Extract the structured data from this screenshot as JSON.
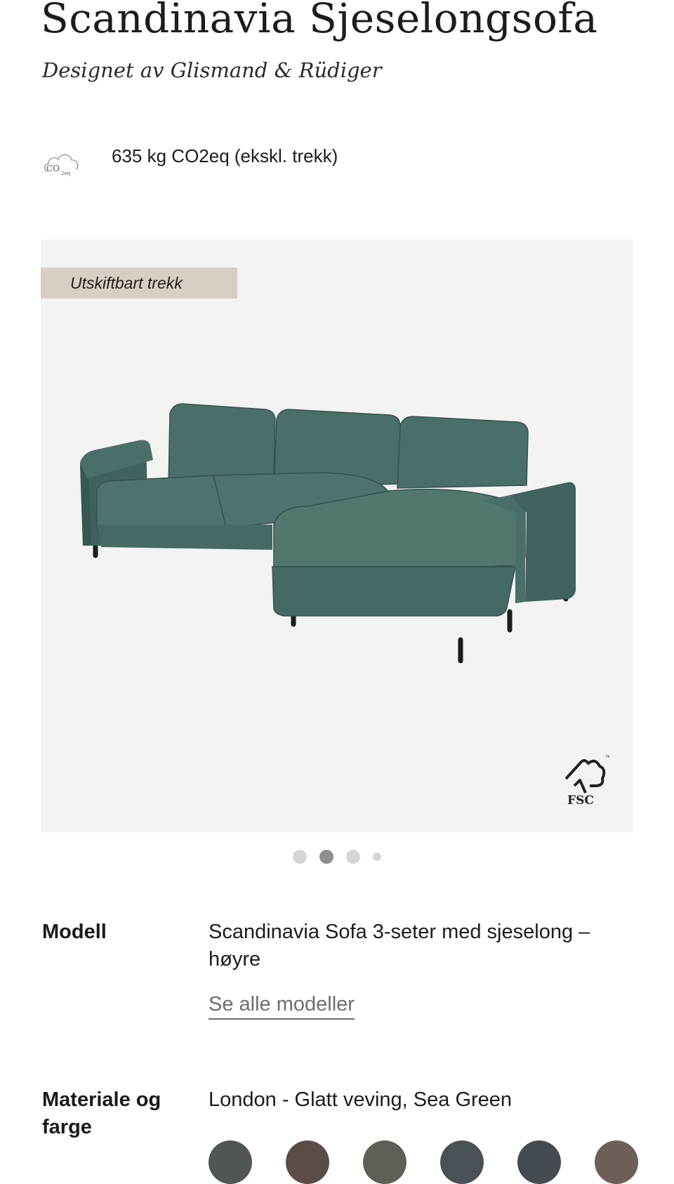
{
  "product": {
    "title": "Scandinavia Sjeselongsofa",
    "designer": "Designet av Glismand & Rüdiger"
  },
  "co2": {
    "icon": "co2-cloud-icon",
    "icon_label": "CO",
    "icon_sub": "2eq",
    "text": "635 kg CO2eq (ekskl. trekk)"
  },
  "gallery": {
    "badge": "Utskiftbart trekk",
    "image": "sofa-image",
    "certification_icon": "fsc-logo",
    "fsc_label": "FSC",
    "fsc_tm": "™",
    "slide_count": 4,
    "active_slide": 2,
    "sofa_color": "#4a6f6b"
  },
  "specs": {
    "model": {
      "label": "Modell",
      "value": "Scandinavia Sofa 3-seter med sjeselong – høyre",
      "link": "Se alle modeller"
    },
    "material": {
      "label": "Materiale og farge",
      "value": "London - Glatt veving, Sea Green",
      "swatch_colors": [
        "#4f5654",
        "#5a4d48",
        "#5b6154",
        "#4b5257",
        "#454b53",
        "#6b5f57"
      ]
    }
  },
  "colors": {
    "badge_bg": "#d8cec4",
    "gallery_bg": "#f3f3f3",
    "link": "#6e6e6e"
  }
}
